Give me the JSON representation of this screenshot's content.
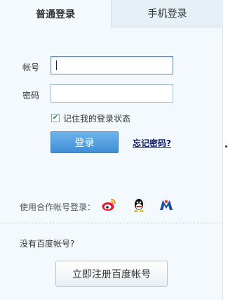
{
  "tabs": [
    {
      "label": "普通登录",
      "active": true
    },
    {
      "label": "手机登录",
      "active": false
    }
  ],
  "form": {
    "account_label": "帐号",
    "account_value": "",
    "password_label": "密码",
    "password_value": "",
    "remember_label": "记住我的登录状态",
    "remember_checked": true,
    "login_button": "登录",
    "forgot_link": "忘记密码?"
  },
  "partners": {
    "label": "使用合作帐号登录：",
    "icons": [
      "weibo-icon",
      "qq-icon",
      "renren-icon"
    ]
  },
  "register": {
    "prompt": "没有百度帐号?",
    "button": "立即注册百度帐号"
  },
  "colors": {
    "accent": "#4a9be0",
    "panel_bg": "#f4f9fd",
    "link": "#0b1a6b"
  }
}
